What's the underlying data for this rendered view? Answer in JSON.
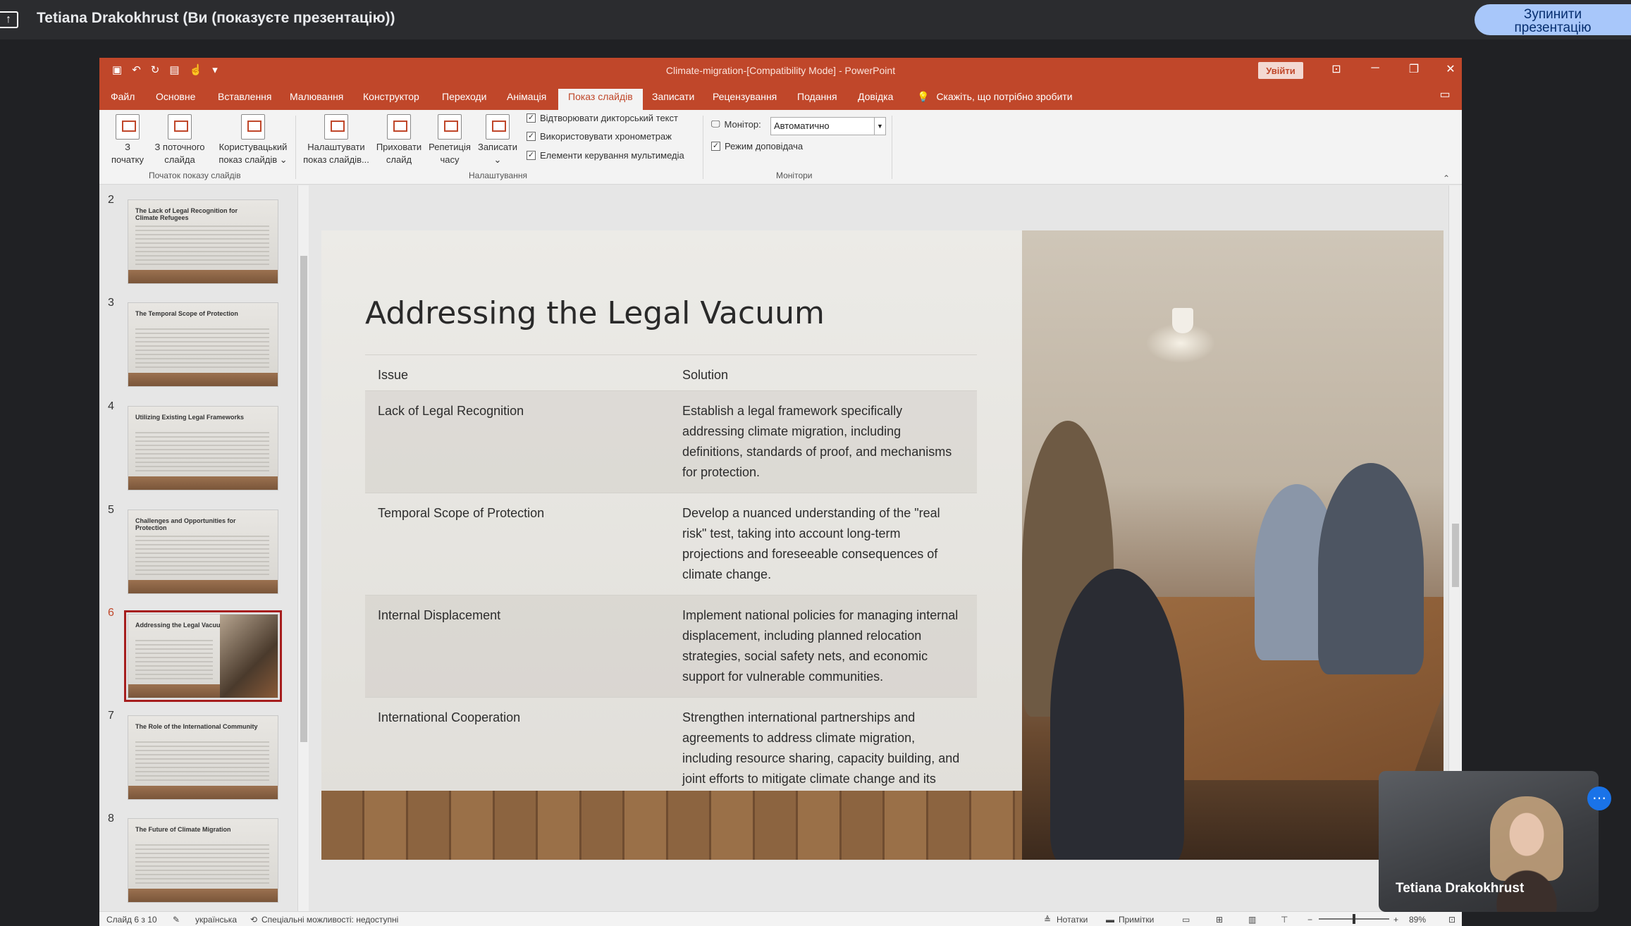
{
  "meet": {
    "presenter_title": "Tetiana Drakokhrust (Ви (показуєте презентацію))",
    "stop_button": "Зупинити\nпрезентацію",
    "self_view_name": "Tetiana Drakokhrust"
  },
  "window": {
    "doc_title": "Climate-migration-[Compatibility Mode]  -  PowerPoint",
    "signin": "Увійти",
    "tabs": [
      "Файл",
      "Основне",
      "Вставлення",
      "Малювання",
      "Конструктор",
      "Переходи",
      "Анімація",
      "Показ слайдів",
      "Записати",
      "Рецензування",
      "Подання",
      "Довідка"
    ],
    "active_tab": "Показ слайдів",
    "tell_me": "Скажіть, що потрібно зробити"
  },
  "ribbon": {
    "from_start": "З\nпочатку",
    "from_current": "З поточного\nслайда",
    "custom_show": "Користувацький\nпоказ слайдів ⌄",
    "group_start": "Початок показу слайдів",
    "setup_show": "Налаштувати\nпоказ слайдів...",
    "hide_slide": "Приховати\nслайд",
    "rehearse": "Репетиція\nчасу",
    "record": "Записати\n⌄",
    "chk_narration": "Відтворювати дикторський текст",
    "chk_timings": "Використовувати хронометраж",
    "chk_media": "Елементи керування мультимедіа",
    "group_setup": "Налаштування",
    "monitor_label": "Монітор:",
    "monitor_value": "Автоматично",
    "presenter_view": "Режим доповідача",
    "group_monitors": "Монітори"
  },
  "thumbnails": [
    {
      "num": "2",
      "title": "The Lack of Legal Recognition for Climate Refugees"
    },
    {
      "num": "3",
      "title": "The Temporal Scope of Protection"
    },
    {
      "num": "4",
      "title": "Utilizing Existing Legal Frameworks"
    },
    {
      "num": "5",
      "title": "Challenges and Opportunities for Protection"
    },
    {
      "num": "6",
      "title": "Addressing the Legal Vacuum"
    },
    {
      "num": "7",
      "title": "The Role of the International Community"
    },
    {
      "num": "8",
      "title": "The Future of Climate Migration"
    }
  ],
  "slide": {
    "title": "Addressing the Legal Vacuum",
    "header": {
      "issue": "Issue",
      "solution": "Solution"
    },
    "rows": [
      {
        "issue": "Lack of Legal Recognition",
        "solution": "Establish a legal framework specifically addressing climate migration, including definitions, standards of proof, and mechanisms for protection."
      },
      {
        "issue": "Temporal Scope of Protection",
        "solution": "Develop a nuanced understanding of the \"real risk\" test, taking into account long-term projections and foreseeable consequences of climate change."
      },
      {
        "issue": "Internal Displacement",
        "solution": "Implement national policies for managing internal displacement, including planned relocation strategies, social safety nets, and economic support for vulnerable communities."
      },
      {
        "issue": "International Cooperation",
        "solution": "Strengthen international partnerships and agreements to address climate migration, including resource sharing, capacity building, and joint efforts to mitigate climate change and its consequences."
      }
    ]
  },
  "status": {
    "slide_of": "Слайд 6 з 10",
    "language": "українська",
    "accessibility": "Спеціальні можливості: недоступні",
    "notes": "Нотатки",
    "comments": "Примітки",
    "zoom": "89%"
  },
  "colors": {
    "accent": "#c0472a",
    "meet_button": "#a8c7fa"
  }
}
